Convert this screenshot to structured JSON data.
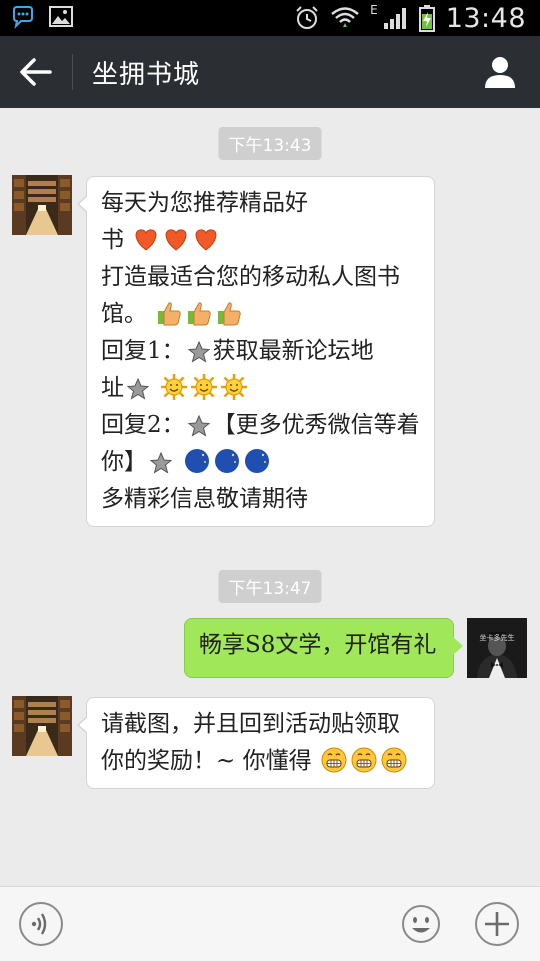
{
  "status_bar": {
    "time": "13:48",
    "network_label": "E",
    "icons": [
      "chat-notification-icon",
      "image-notification-icon",
      "alarm-icon",
      "wifi-icon",
      "cell-signal-icon",
      "battery-charging-icon"
    ]
  },
  "header": {
    "title": "坐拥书城",
    "back_icon": "back-arrow-icon",
    "profile_icon": "profile-icon"
  },
  "messages": [
    {
      "type": "timestamp",
      "text": "下午13:43"
    },
    {
      "type": "incoming",
      "avatar": "library-avatar",
      "lines": [
        {
          "text": "每天为您推荐精品好"
        },
        {
          "text": "书",
          "after": [
            "heart",
            "heart",
            "heart"
          ]
        },
        {
          "text": "打造最适合您的移动私人图书"
        },
        {
          "text": "馆。",
          "after": [
            "thumbs-up",
            "thumbs-up",
            "thumbs-up"
          ]
        },
        {
          "text_a": "回复1：",
          "text_b": "获取最新论坛地"
        },
        {
          "text": "址",
          "after": [
            "star",
            "sun",
            "sun",
            "sun"
          ]
        },
        {
          "text_a": "回复2：",
          "text_b": "【更多优秀微信等着"
        },
        {
          "text": "你】",
          "after": [
            "star",
            "moon",
            "moon",
            "moon"
          ]
        },
        {
          "text": "多精彩信息敬请期待"
        }
      ]
    },
    {
      "type": "timestamp",
      "text": "下午13:47"
    },
    {
      "type": "outgoing",
      "avatar": "gentleman-avatar",
      "avatar_caption": "坐卡多先生",
      "text": "畅享S8文学，开馆有礼"
    },
    {
      "type": "incoming",
      "avatar": "library-avatar",
      "line1": "请截图，并且回到活动贴领取",
      "line2": "你的奖励！~ 你懂得",
      "line2_after": [
        "grin",
        "grin",
        "grin"
      ]
    }
  ],
  "input_bar": {
    "voice_icon": "voice-input-icon",
    "emoji_icon": "emoji-icon",
    "plus_icon": "plus-icon"
  }
}
